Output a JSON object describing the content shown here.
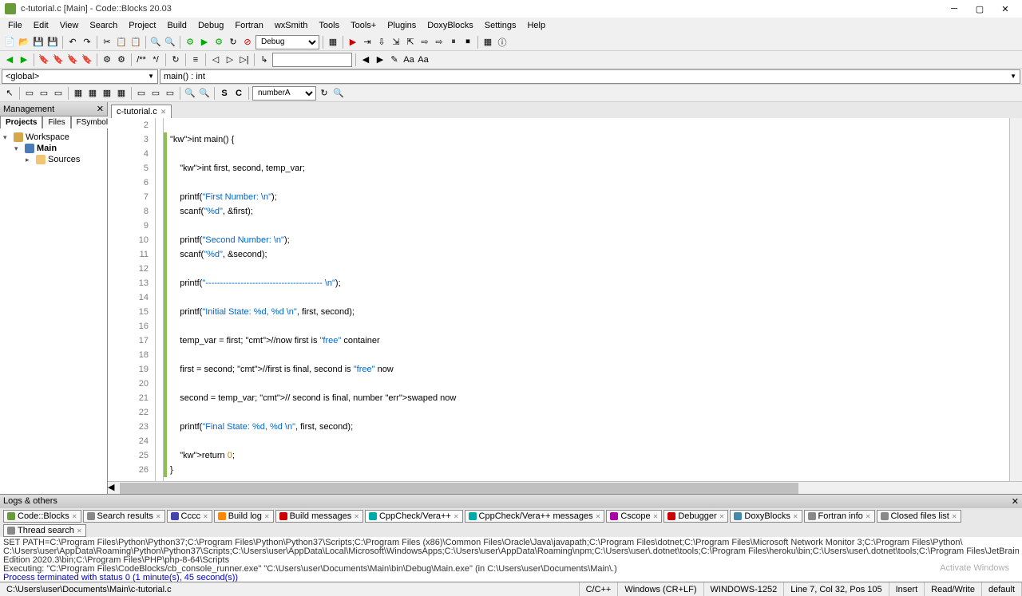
{
  "title": "c-tutorial.c [Main] - Code::Blocks 20.03",
  "menu": [
    "File",
    "Edit",
    "View",
    "Search",
    "Project",
    "Build",
    "Debug",
    "Fortran",
    "wxSmith",
    "Tools",
    "Tools+",
    "Plugins",
    "DoxyBlocks",
    "Settings",
    "Help"
  ],
  "build_target": "Debug",
  "scope_left": "<global>",
  "scope_right": "main() : int",
  "symbol_box": "numberA",
  "sidebar": {
    "title": "Management",
    "tabs": [
      "Projects",
      "Files",
      "FSymbols"
    ],
    "workspace": "Workspace",
    "project": "Main",
    "folder": "Sources"
  },
  "editor_tab": "c-tutorial.c",
  "code_lines": [
    {
      "n": 2,
      "t": ""
    },
    {
      "n": 3,
      "t": "int main() {"
    },
    {
      "n": 4,
      "t": ""
    },
    {
      "n": 5,
      "t": "    int first, second, temp_var;"
    },
    {
      "n": 6,
      "t": ""
    },
    {
      "n": 7,
      "t": "    printf(\"First Number: \\n\");"
    },
    {
      "n": 8,
      "t": "    scanf(\"%d\", &first);"
    },
    {
      "n": 9,
      "t": ""
    },
    {
      "n": 10,
      "t": "    printf(\"Second Number: \\n\");"
    },
    {
      "n": 11,
      "t": "    scanf(\"%d\", &second);"
    },
    {
      "n": 12,
      "t": ""
    },
    {
      "n": 13,
      "t": "    printf(\"---------------------------------------- \\n\");"
    },
    {
      "n": 14,
      "t": ""
    },
    {
      "n": 15,
      "t": "    printf(\"Initial State: %d, %d \\n\", first, second);"
    },
    {
      "n": 16,
      "t": ""
    },
    {
      "n": 17,
      "t": "    temp_var = first; //now first is \"free\" container"
    },
    {
      "n": 18,
      "t": ""
    },
    {
      "n": 19,
      "t": "    first = second; //first is final, second is \"free\" now"
    },
    {
      "n": 20,
      "t": ""
    },
    {
      "n": 21,
      "t": "    second = temp_var; // second is final, number swaped now"
    },
    {
      "n": 22,
      "t": ""
    },
    {
      "n": 23,
      "t": "    printf(\"Final State: %d, %d \\n\", first, second);"
    },
    {
      "n": 24,
      "t": ""
    },
    {
      "n": 25,
      "t": "    return 0;"
    },
    {
      "n": 26,
      "t": "}"
    }
  ],
  "logs": {
    "title": "Logs & others",
    "tabs": [
      "Code::Blocks",
      "Search results",
      "Cccc",
      "Build log",
      "Build messages",
      "CppCheck/Vera++",
      "CppCheck/Vera++ messages",
      "Cscope",
      "Debugger",
      "DoxyBlocks",
      "Fortran info",
      "Closed files list",
      "Thread search"
    ],
    "active_tab": 5,
    "lines": [
      "SET PATH=C:\\Program Files\\Python\\Python37;C:\\Program Files\\Python\\Python37\\Scripts;C:\\Program Files (x86)\\Common Files\\Oracle\\Java\\javapath;C:\\Program Files\\dotnet;C:\\Program Files\\Microsoft Network Monitor 3;C:\\Program Files\\Python\\",
      "C:\\Users\\user\\AppData\\Roaming\\Python\\Python37\\Scripts;C:\\Users\\user\\AppData\\Local\\Microsoft\\WindowsApps;C:\\Users\\user\\AppData\\Roaming\\npm;C:\\Users\\user\\.dotnet\\tools;C:\\Program Files\\heroku\\bin;C:\\Users\\user\\.dotnet\\tools;C:\\Program Files\\JetBrains\\PyCharm Community",
      "Edition 2020.3\\bin;C:\\Program Files\\PHP\\php-8-64\\Scripts",
      "Executing: \"C:\\Program Files\\CodeBlocks/cb_console_runner.exe\" \"C:\\Users\\user\\Documents\\Main\\bin\\Debug\\Main.exe\"  (in C:\\Users\\user\\Documents\\Main\\.)",
      "Process terminated with status 0 (1 minute(s), 45 second(s))"
    ]
  },
  "status": {
    "path": "C:\\Users\\user\\Documents\\Main\\c-tutorial.c",
    "lang": "C/C++",
    "enc": "Windows (CR+LF)",
    "cp": "WINDOWS-1252",
    "pos": "Line 7, Col 32, Pos 105",
    "ins": "Insert",
    "rw": "Read/Write",
    "prof": "default"
  },
  "activate": "Activate Windows"
}
